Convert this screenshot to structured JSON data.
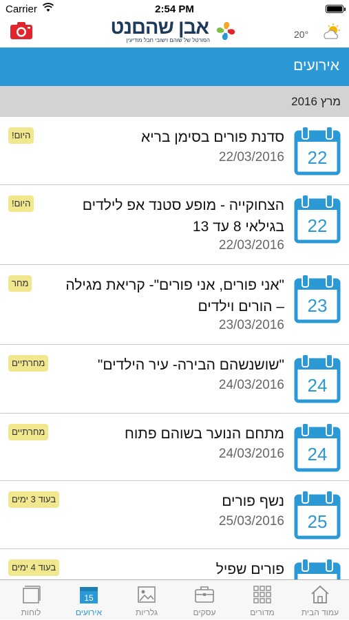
{
  "status": {
    "carrier": "Carrier",
    "time": "2:54 PM"
  },
  "header": {
    "logo_text": "אבן שהםנט",
    "logo_tagline": "הפורטל של שוהם וישובי חבל מודיעין",
    "weather_temp": "20°",
    "camera_icon": "camera-icon",
    "weather_icon": "partly-cloudy-sun-icon"
  },
  "page": {
    "title": "אירועים",
    "month_header": "מרץ 2016"
  },
  "events": [
    {
      "day": "22",
      "title": "סדנת פורים בסימן בריא",
      "date": "22/03/2016",
      "badge": "היום!"
    },
    {
      "day": "22",
      "title": "הצחוקייה - מופע סטנד אפ לילדים בגילאי 8 עד 13",
      "date": "22/03/2016",
      "badge": "היום!"
    },
    {
      "day": "23",
      "title": "\"אני פורים, אני פורים\"- קריאת מגילה – הורים וילדים",
      "date": "23/03/2016",
      "badge": "מחר"
    },
    {
      "day": "24",
      "title": "\"שושנשהם הבירה- עיר הילדים\"",
      "date": "24/03/2016",
      "badge": "מחרתיים"
    },
    {
      "day": "24",
      "title": "מתחם הנוער בשוהם פתוח",
      "date": "24/03/2016",
      "badge": "מחרתיים"
    },
    {
      "day": "25",
      "title": "נשף פורים",
      "date": "25/03/2016",
      "badge": "בעוד 3 ימים"
    },
    {
      "day": "",
      "title": "פורים שפיל",
      "date": "",
      "badge": "בעוד 4 ימים"
    }
  ],
  "tabs": [
    {
      "label": "עמוד הבית",
      "icon": "home-icon"
    },
    {
      "label": "מדורים",
      "icon": "grid-icon"
    },
    {
      "label": "עסקים",
      "icon": "briefcase-icon"
    },
    {
      "label": "גלריות",
      "icon": "gallery-icon"
    },
    {
      "label": "אירועים",
      "icon": "calendar-icon",
      "icon_text": "15"
    },
    {
      "label": "לוחות",
      "icon": "boards-icon"
    }
  ],
  "colors": {
    "accent": "#2a99d5",
    "badge": "#f1e78f",
    "camera": "#e0262c",
    "brand": "#1d3a5c"
  }
}
